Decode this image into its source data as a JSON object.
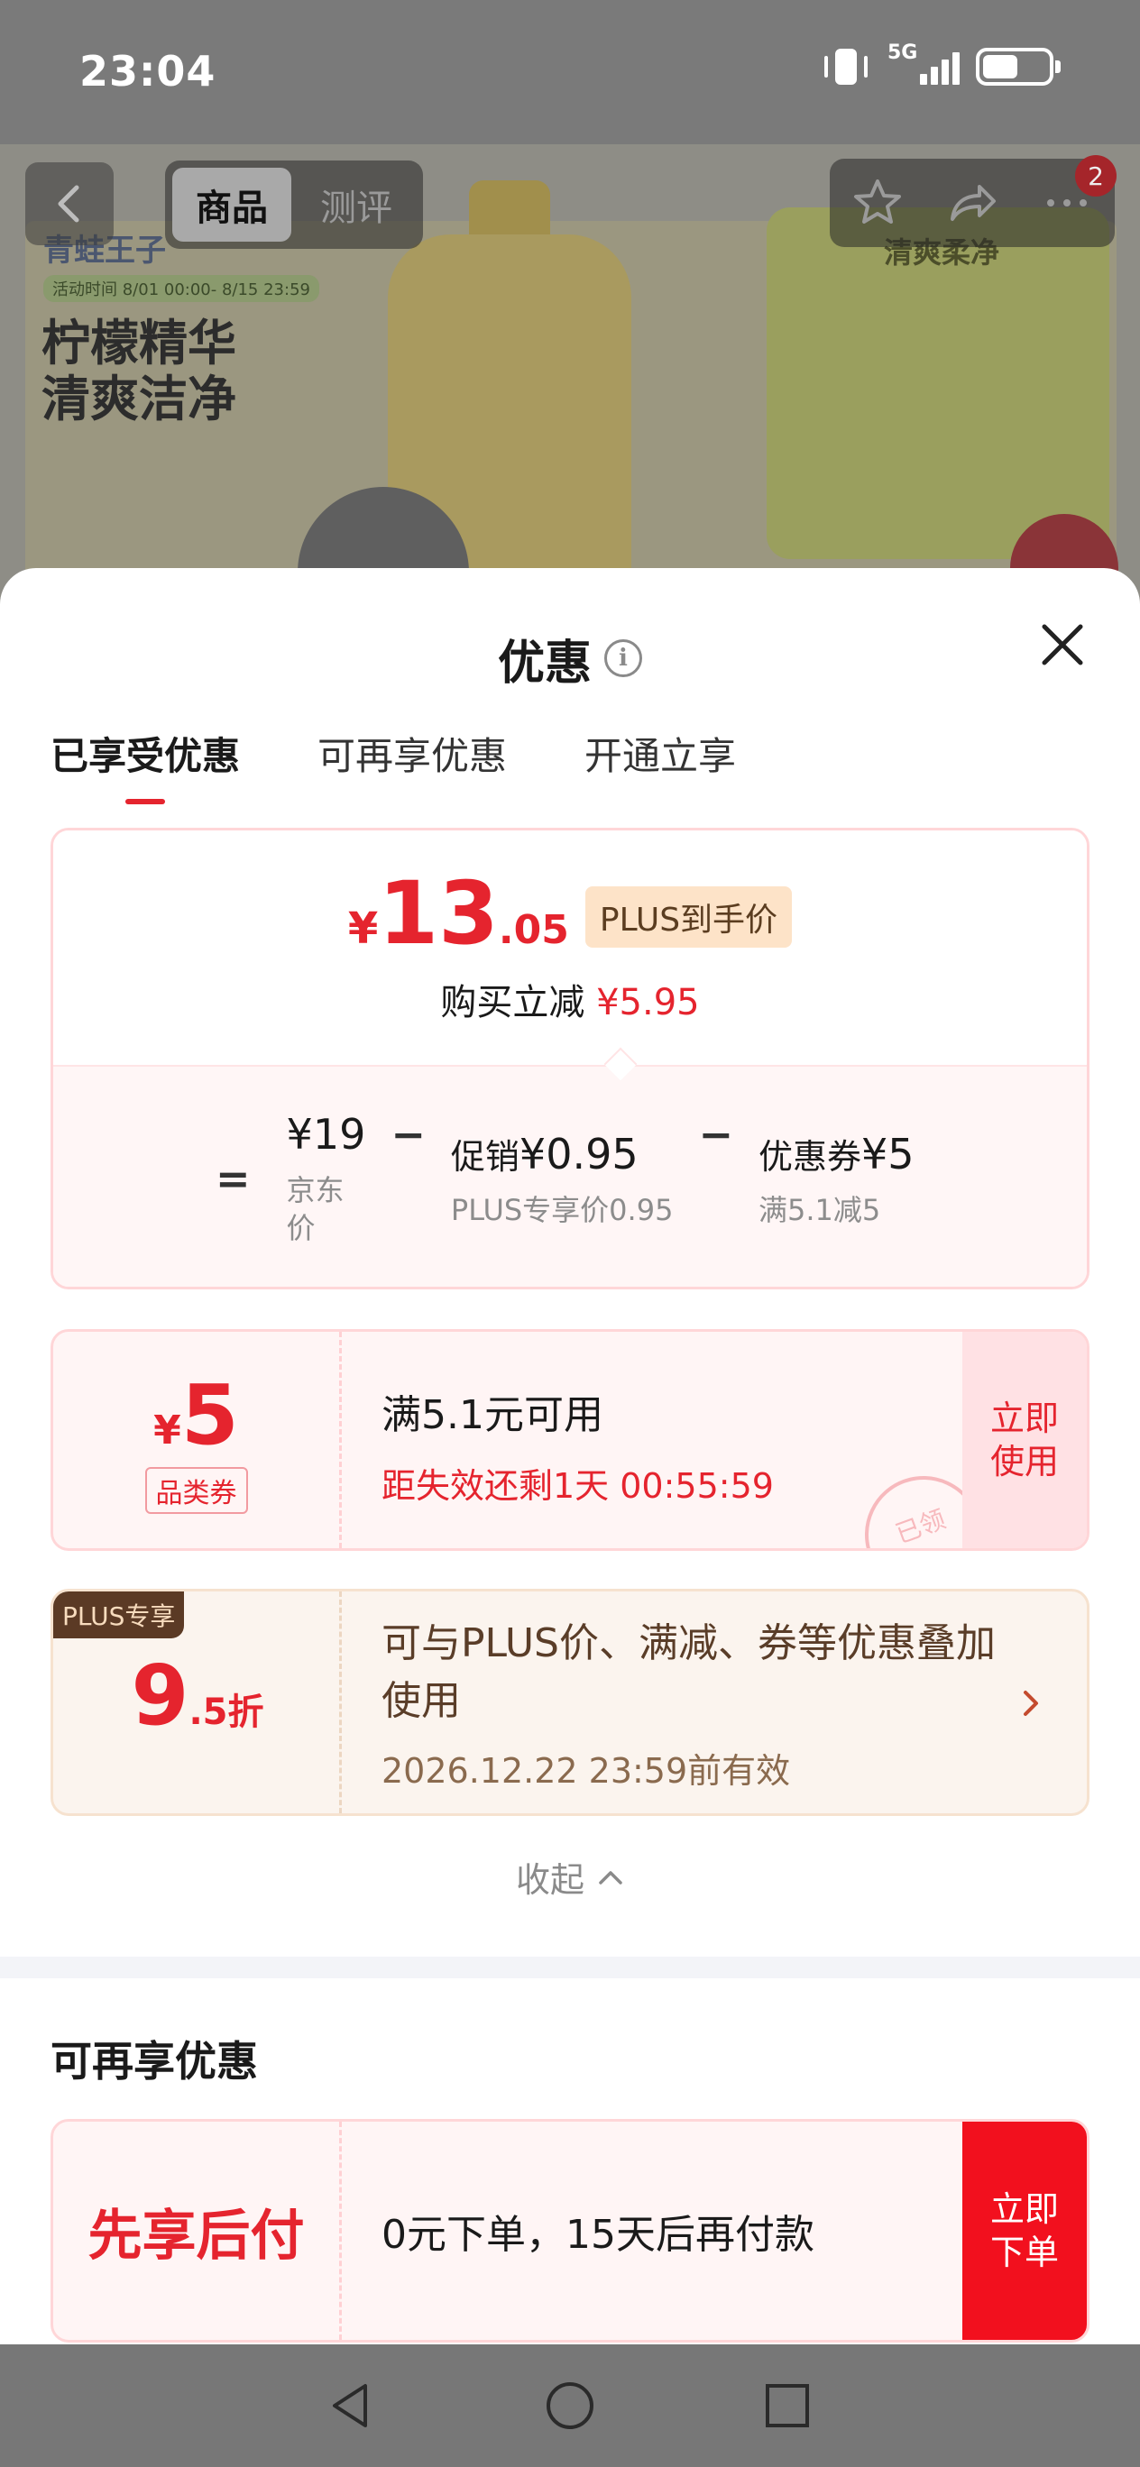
{
  "status_bar": {
    "time": "23:04",
    "network": "5G"
  },
  "product_page": {
    "tabs": [
      "商品",
      "测评"
    ],
    "active_tab": "商品",
    "cart_badge": "2",
    "banner": {
      "brand": "青蛙王子",
      "activity_time": "活动时间 8/01 00:00- 8/15 23:59",
      "headline_1": "柠檬精华",
      "headline_2": "清爽洁净",
      "box_title": "清爽柔净"
    }
  },
  "sheet": {
    "title": "优惠",
    "tabs": [
      "已享受优惠",
      "可再享优惠",
      "开通立享"
    ],
    "active_tab": "已享受优惠",
    "price_card": {
      "currency": "¥",
      "price_int": "13",
      "price_dec": ".05",
      "plus_tag": "PLUS到手价",
      "reduce_label": "购买立减",
      "reduce_amount": "¥5.95",
      "formula": {
        "equals": "=",
        "minus": "−",
        "jd_price": "¥19",
        "jd_price_label": "京东价",
        "promo_label": "促销",
        "promo_value": "¥0.95",
        "promo_sub": "PLUS专享价0.95",
        "coupon_label": "优惠券",
        "coupon_value": "¥5",
        "coupon_sub": "满5.1减5"
      }
    },
    "coupon": {
      "currency": "¥",
      "amount": "5",
      "type": "品类券",
      "condition": "满5.1元可用",
      "expire": "距失效还剩1天 00:55:59",
      "action": "立即使用",
      "stamp": "已领"
    },
    "plus_card": {
      "label": "PLUS专享",
      "rate_int": "9",
      "rate_suffix": ".5折",
      "description": "可与PLUS价、满减、券等优惠叠加使用",
      "valid_until": "2026.12.22 23:59前有效"
    },
    "collapse_label": "收起",
    "more_section_title": "可再享优惠",
    "pay_later": {
      "title": "先享后付",
      "description": "0元下单，15天后再付款",
      "action": "立即下单"
    }
  },
  "colors": {
    "accent": "#e5242e",
    "plus_brown": "#5b3a25"
  }
}
